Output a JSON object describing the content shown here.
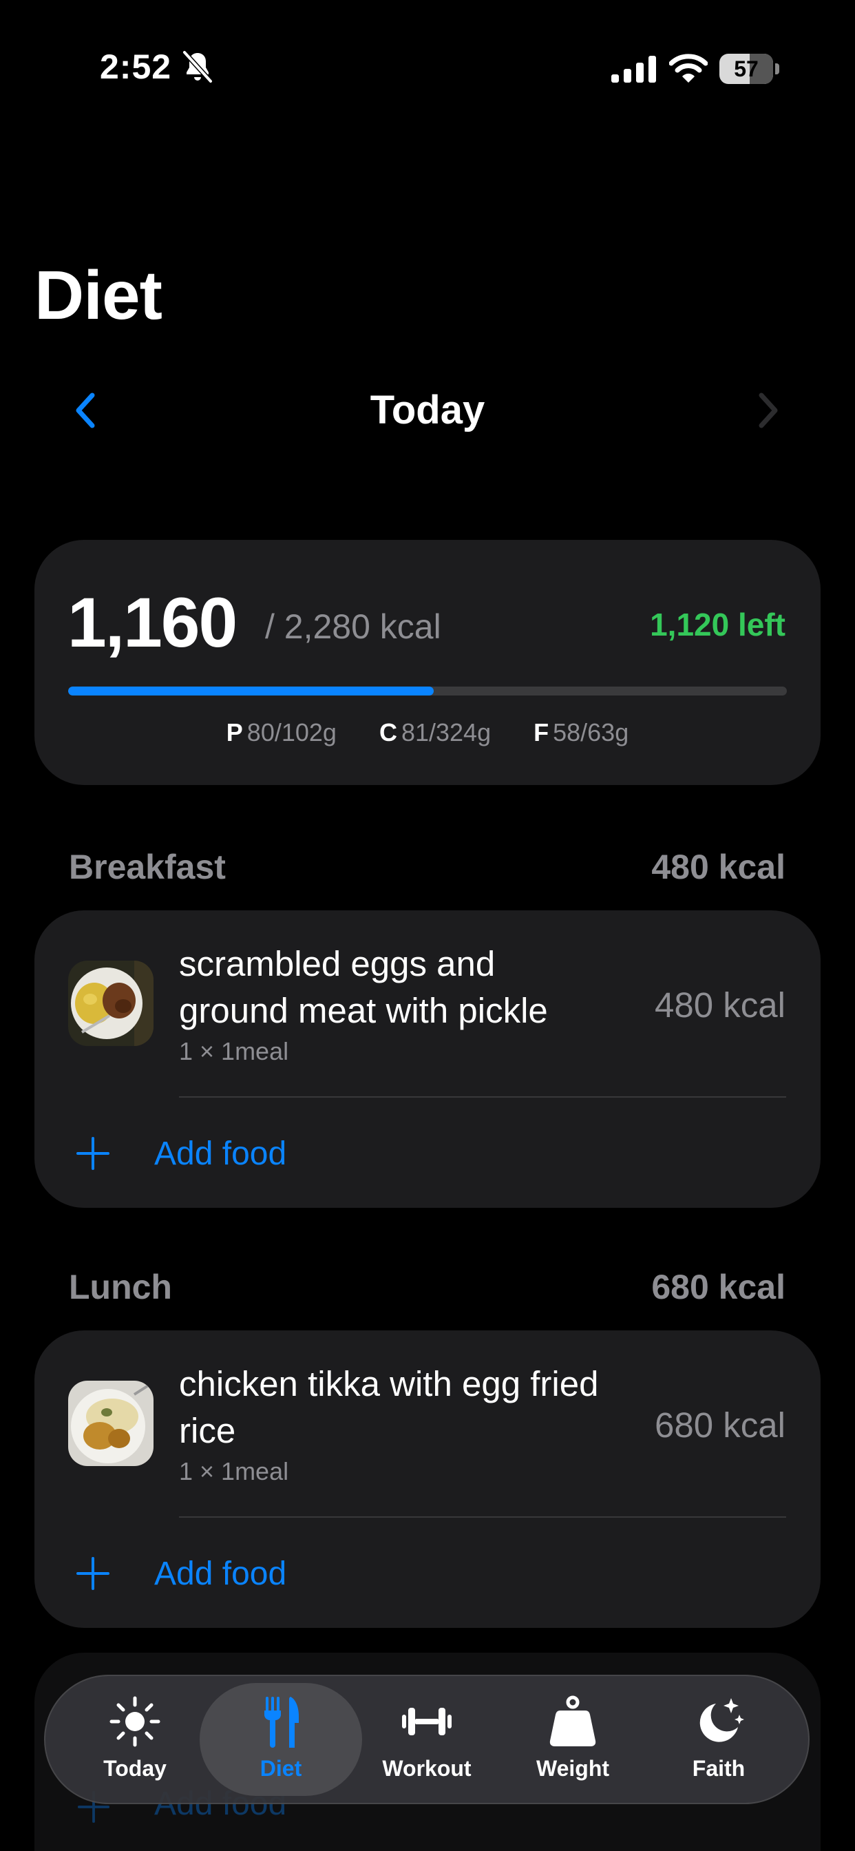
{
  "status_bar": {
    "time": "2:52",
    "battery": "57"
  },
  "header": {
    "title": "Diet",
    "date_label": "Today"
  },
  "summary": {
    "consumed": "1,160",
    "goal": "/ 2,280 kcal",
    "remaining": "1,120 left",
    "progress": 0.509,
    "macros": [
      {
        "letter": "P",
        "value": "80/102g"
      },
      {
        "letter": "C",
        "value": "81/324g"
      },
      {
        "letter": "F",
        "value": "58/63g"
      }
    ]
  },
  "meals": [
    {
      "name": "Breakfast",
      "kcal": "480 kcal",
      "items": [
        {
          "name": "scrambled eggs and ground meat with pickle",
          "qty": "1 × 1meal",
          "kcal": "480 kcal"
        }
      ],
      "add_label": "Add food"
    },
    {
      "name": "Lunch",
      "kcal": "680 kcal",
      "items": [
        {
          "name": "chicken tikka with egg fried rice",
          "qty": "1 × 1meal",
          "kcal": "680 kcal"
        }
      ],
      "add_label": "Add food"
    }
  ],
  "ghost_add_label": "Add food",
  "tabs": [
    {
      "label": "Today",
      "icon": "sun-icon"
    },
    {
      "label": "Diet",
      "icon": "fork-knife-icon",
      "active": true
    },
    {
      "label": "Workout",
      "icon": "dumbbell-icon"
    },
    {
      "label": "Weight",
      "icon": "scale-weight-icon"
    },
    {
      "label": "Faith",
      "icon": "moon-stars-icon"
    }
  ],
  "colors": {
    "accent": "#0a84ff",
    "positive": "#34c759",
    "card": "#1c1c1e",
    "muted": "#8e8e93"
  }
}
